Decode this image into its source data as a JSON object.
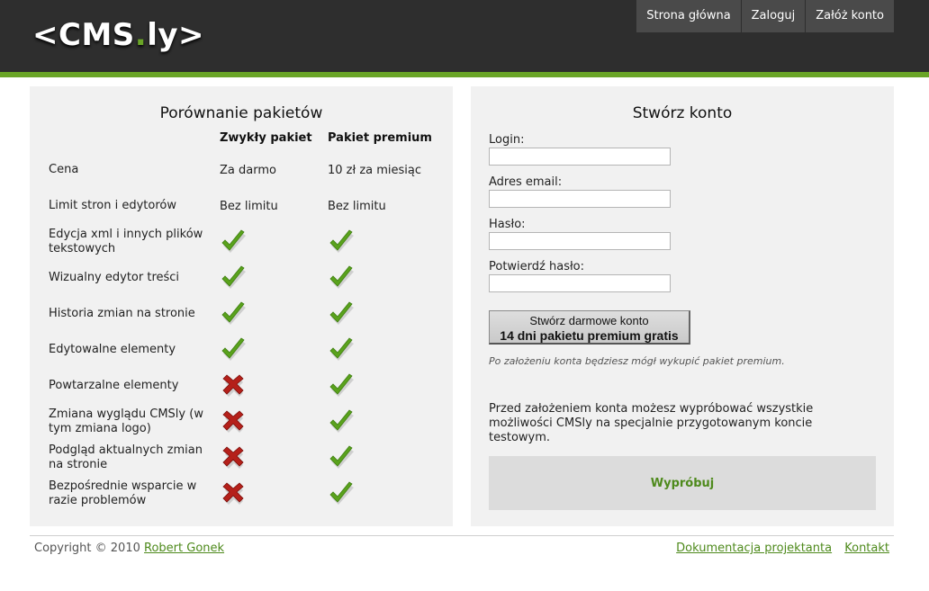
{
  "header": {
    "logo_left": "<CMS",
    "logo_dot": ".",
    "logo_right": "ly>",
    "nav": [
      {
        "label": "Strona główna"
      },
      {
        "label": "Zaloguj"
      },
      {
        "label": "Załóż konto"
      }
    ]
  },
  "compare": {
    "title": "Porównanie pakietów",
    "col_basic": "Zwykły pakiet",
    "col_premium": "Pakiet premium",
    "rows": [
      {
        "label": "Cena",
        "basic": "Za darmo",
        "premium": "10 zł za miesiąc"
      },
      {
        "label": "Limit stron i edytorów",
        "basic": "Bez limitu",
        "premium": "Bez limitu"
      },
      {
        "label": "Edycja xml i innych plików tekstowych",
        "basic": "check-icon",
        "premium": "check-icon"
      },
      {
        "label": "Wizualny edytor treści",
        "basic": "check-icon",
        "premium": "check-icon"
      },
      {
        "label": "Historia zmian na stronie",
        "basic": "check-icon",
        "premium": "check-icon"
      },
      {
        "label": "Edytowalne elementy",
        "basic": "check-icon",
        "premium": "check-icon"
      },
      {
        "label": "Powtarzalne elementy",
        "basic": "cross-icon",
        "premium": "check-icon"
      },
      {
        "label": "Zmiana wyglądu CMSly (w tym zmiana logo)",
        "basic": "cross-icon",
        "premium": "check-icon"
      },
      {
        "label": "Podgląd aktualnych zmian na stronie",
        "basic": "cross-icon",
        "premium": "check-icon"
      },
      {
        "label": "Bezpośrednie wsparcie w razie problemów",
        "basic": "cross-icon",
        "premium": "check-icon"
      }
    ]
  },
  "signup": {
    "title": "Stwórz konto",
    "login_label": "Login:",
    "login_value": "",
    "email_label": "Adres email:",
    "email_value": "",
    "password_label": "Hasło:",
    "password_value": "",
    "confirm_label": "Potwierdź hasło:",
    "confirm_value": "",
    "button_line1": "Stwórz darmowe konto",
    "button_line2": "14 dni pakietu premium gratis",
    "note": "Po założeniu konta będziesz mógł wykupić pakiet premium.",
    "info": "Przed założeniem konta możesz wypróbować wszystkie możliwości CMSly na specjalnie przygotowanym koncie testowym.",
    "try_label": "Wypróbuj"
  },
  "footer": {
    "copyright": "Copyright © 2010",
    "author": "Robert Gonek",
    "links": [
      {
        "label": "Dokumentacja projektanta"
      },
      {
        "label": "Kontakt"
      }
    ]
  },
  "colors": {
    "accent": "#6aa527",
    "link": "#4e8a1c",
    "header_bg": "#2e2e2e",
    "check": "#5aa21c",
    "cross": "#b5201a"
  }
}
